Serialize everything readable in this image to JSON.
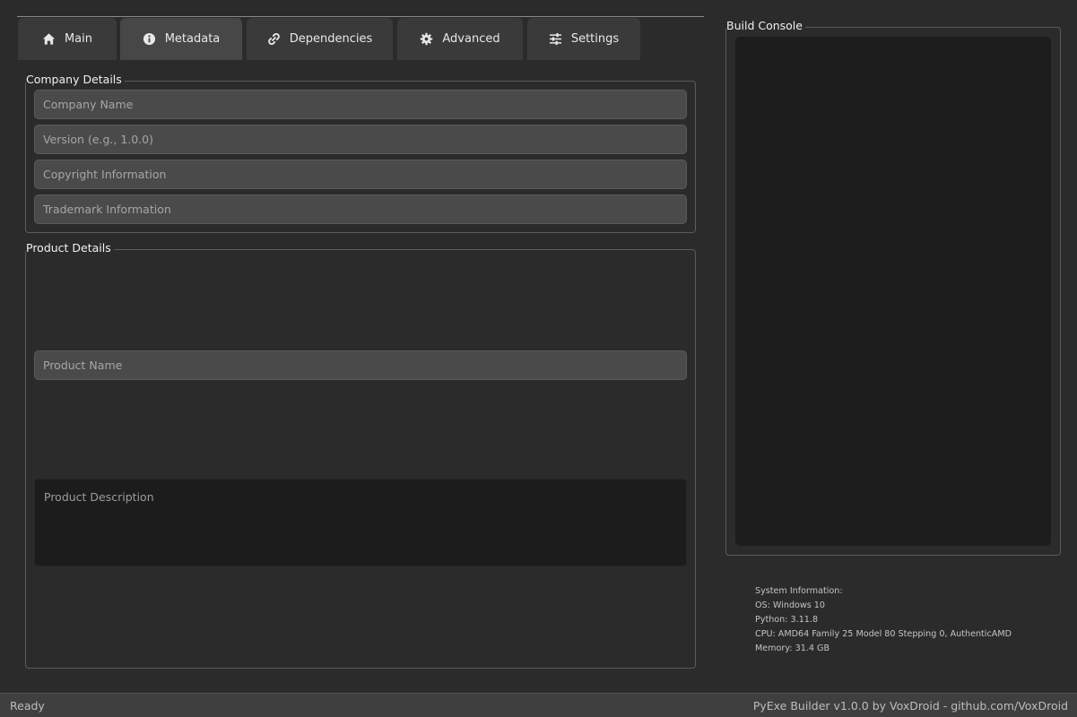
{
  "tabs": [
    {
      "label": "Main",
      "icon": "home-icon"
    },
    {
      "label": "Metadata",
      "icon": "info-icon"
    },
    {
      "label": "Dependencies",
      "icon": "link-icon"
    },
    {
      "label": "Advanced",
      "icon": "gear-icon"
    },
    {
      "label": "Settings",
      "icon": "sliders-icon"
    }
  ],
  "active_tab": "Metadata",
  "company": {
    "title": "Company Details",
    "company_name_placeholder": "Company Name",
    "version_placeholder": "Version (e.g., 1.0.0)",
    "copyright_placeholder": "Copyright Information",
    "trademark_placeholder": "Trademark Information"
  },
  "product": {
    "title": "Product Details",
    "name_placeholder": "Product Name",
    "description_placeholder": "Product Description"
  },
  "console": {
    "title": "Build Console"
  },
  "sysinfo": {
    "header": "System Information:",
    "os": "OS: Windows 10",
    "python": "Python: 3.11.8",
    "cpu": "CPU: AMD64 Family 25 Model 80 Stepping 0, AuthenticAMD",
    "memory": "Memory: 31.4 GB"
  },
  "status": {
    "left": "Ready",
    "right": "PyExe Builder v1.0.0 by VoxDroid - github.com/VoxDroid"
  },
  "colors": {
    "background": "#2b2b2b",
    "tab": "#3a3a3a",
    "tab_active": "#474747",
    "input": "#4a4a4a",
    "console": "#1d1d1d"
  }
}
